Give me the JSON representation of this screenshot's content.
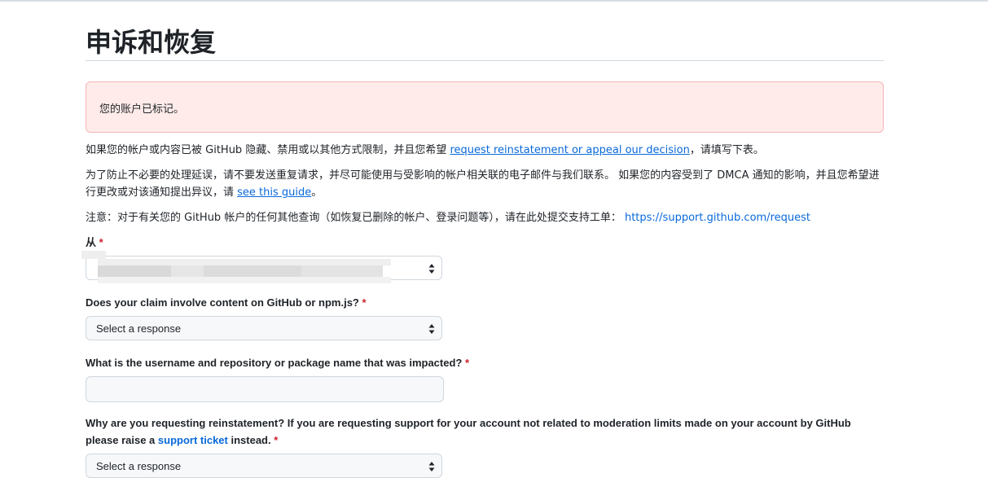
{
  "page": {
    "title": "申诉和恢复"
  },
  "flash": {
    "message": "您的账户已标记。"
  },
  "intro": {
    "p1_before": "如果您的帐户或内容已被 GitHub 隐藏、禁用或以其他方式限制，并且您希望 ",
    "p1_link": "request reinstatement or appeal our decision",
    "p1_after": "，请填写下表。",
    "p2_before": "为了防止不必要的处理延误，请不要发送重复请求，并尽可能使用与受影响的帐户相关联的电子邮件与我们联系。 如果您的内容受到了 DMCA 通知的影响，并且您希望进行更改或对该通知提出异议，请 ",
    "p2_link": "see this guide",
    "p2_after": "。",
    "p3_before": "注意：对于有关您的 GitHub 帐户的任何其他查询（如恢复已删除的帐户、登录问题等），请在此处提交支持工单： ",
    "p3_link": "https://support.github.com/request"
  },
  "form": {
    "from_label": "从",
    "required_mark": "*",
    "from_value": "",
    "q1_label": "Does your claim involve content on GitHub or npm.js?",
    "q1_value": "Select a response",
    "q2_label": "What is the username and repository or package name that was impacted?",
    "q2_value": "",
    "q3_label_before": "Why are you requesting reinstatement? If you are requesting support for your account not related to moderation limits made on your account by GitHub",
    "q3_label_line2_before": "please raise a ",
    "q3_link": "support ticket",
    "q3_label_after": " instead.",
    "q3_value": "Select a response"
  }
}
